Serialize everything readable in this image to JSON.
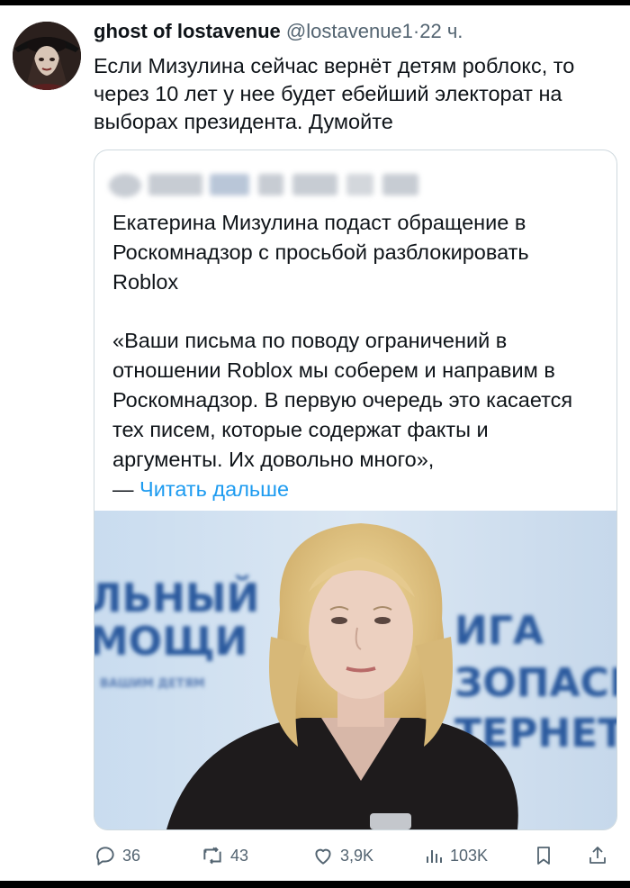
{
  "post": {
    "display_name": "ghost of lostavenue",
    "handle": "@lostavenue1",
    "separator": "·",
    "time": "22 ч.",
    "text": "Если Мизулина сейчас вернёт детям роблокс, то через 10 лет у нее будет ебейший электорат на выборах президента. Думойте"
  },
  "quoted": {
    "headline": "Екатерина Мизулина подаст обращение в Роскомнадзор с просьбой разблокировать Roblox",
    "quote": "«Ваши письма по поводу ограничений в отношении Roblox мы соберем и направим в Роскомнадзор. В первую очередь это касается тех писем, которые содержат факты и аргументы. Их довольно много»,",
    "dash": "— ",
    "read_more": "Читать дальше",
    "photo_sign_left": [
      "ЛЬНЫЙ",
      "МОЩИ",
      "ВАШИМ ДЕТЯМ"
    ],
    "photo_sign_right": [
      "ИГА",
      "ЗОПАСНО",
      "ТЕРНЕТА"
    ]
  },
  "actions": {
    "replies": "36",
    "reposts": "43",
    "likes": "3,9K",
    "views": "103K"
  },
  "colors": {
    "accent": "#1d9bf0",
    "secondary_text": "#536471",
    "primary_text": "#0f1419",
    "border": "#cfd9de"
  },
  "icons": [
    "reply-icon",
    "repost-icon",
    "like-icon",
    "views-icon",
    "bookmark-icon",
    "share-icon"
  ]
}
